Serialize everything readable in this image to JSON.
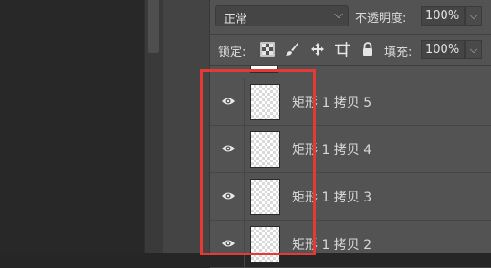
{
  "options": {
    "blend_mode": "正常",
    "opacity_label": "不透明度:",
    "opacity_value": "100%"
  },
  "lock_row": {
    "lock_label": "锁定:",
    "fill_label": "填充:",
    "fill_value": "100%",
    "lock_icons": [
      "transparency-lock-icon",
      "brush-lock-icon",
      "move-lock-icon",
      "artboard-lock-icon",
      "padlock-icon"
    ]
  },
  "layers": [
    {
      "name": "矩形 1 拷贝 5",
      "visible": true
    },
    {
      "name": "矩形 1 拷贝 4",
      "visible": true
    },
    {
      "name": "矩形 1 拷贝 3",
      "visible": true
    },
    {
      "name": "矩形 1 拷贝 2",
      "visible": true
    }
  ],
  "colors": {
    "panel_bg": "#535353",
    "highlight": "#e53935"
  }
}
